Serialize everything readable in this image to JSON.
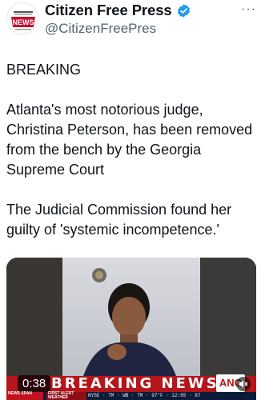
{
  "account": {
    "display_name": "Citizen Free Press",
    "handle": "@CitizenFreePres",
    "avatar_logo_text": "NEWS",
    "verified": true
  },
  "more_label": "···",
  "tweet": {
    "paragraphs": [
      "BREAKING",
      "Atlanta's most notorious judge, Christina Peterson, has been removed from the bench by the Georgia Supreme Court",
      "The Judicial Commission found her guilty of 'systemic incompetence.'"
    ]
  },
  "media": {
    "duration": "0:38",
    "banner_text": "BREAKING NEWS",
    "network_logo": "ANC",
    "ticker_left_label": "NEWS SPAN",
    "ticker_mid_label": "FIRST ALERT WEATHER",
    "ticker_right": "NYSE  ·  TM  ·  WB  ·  TM  ·  97°F  ·  12:05  ·  87"
  },
  "colors": {
    "brand_red": "#b4161b",
    "verified_blue": "#1d9bf0",
    "text": "#0f1419",
    "secondary_text": "#536471"
  }
}
